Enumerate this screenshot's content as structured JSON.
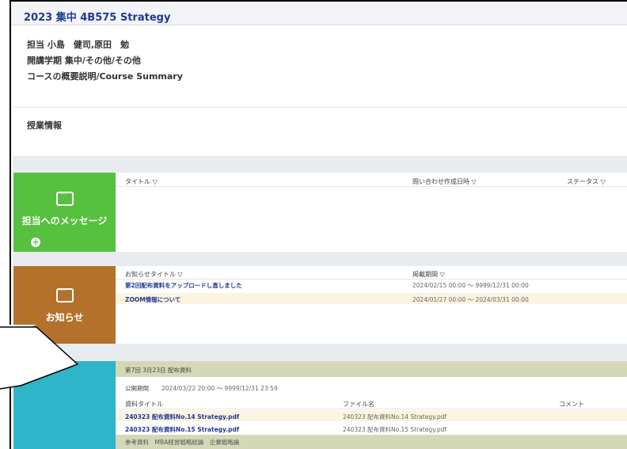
{
  "course": {
    "title": "2023 集中 4B575 Strategy",
    "instructor": "担当 小島　健司,原田　勉",
    "term": "開講学期 集中/その他/その他",
    "summary": "コースの概要説明/Course Summary",
    "class_info": "授業情報"
  },
  "messages": {
    "label": "担当へのメッセージ",
    "icon": "chat-bubble-icon",
    "col_title": "タイトル ▽",
    "col_date": "問い合わせ作成日時 ▽",
    "col_status": "ステータス ▽"
  },
  "notices": {
    "label": "お知らせ",
    "icon": "chat-bubble-icon",
    "col_title": "お知らせタイトル ▽",
    "col_period": "掲載期間 ▽",
    "rows": [
      {
        "title": "第2回配布資料をアップロードし直しました",
        "period": "2024/02/15 00:00 ～ 9999/12/31 00:00"
      },
      {
        "title": "ZOOM情報について",
        "period": "2024/01/27 00:00 ～ 2024/03/31 00:00"
      }
    ]
  },
  "materials": {
    "section": "第7回 3月23日 配布資料",
    "public_label": "公開期間",
    "public_period": "2024/03/22 20:00 ～ 9999/12/31 23:59",
    "col_title": "資料タイトル",
    "col_file": "ファイル名",
    "col_comment": "コメント",
    "rows": [
      {
        "title": "240323 配布資料No.14 Strategy.pdf",
        "file": "240323 配布資料No.14 Strategy.pdf"
      },
      {
        "title": "240323 配布資料No.15 Strategy.pdf",
        "file": "240323 配布資料No.15 Strategy.pdf"
      }
    ],
    "next_section": "参考資料　MBA経営戦略総論　企業戦略論"
  },
  "colors": {
    "message_card": "#56c03f",
    "notice_card": "#b4712b",
    "materials_card": "#2fb5c9",
    "section_band": "#d5d8b6",
    "row_highlight": "#fdf3e1"
  }
}
